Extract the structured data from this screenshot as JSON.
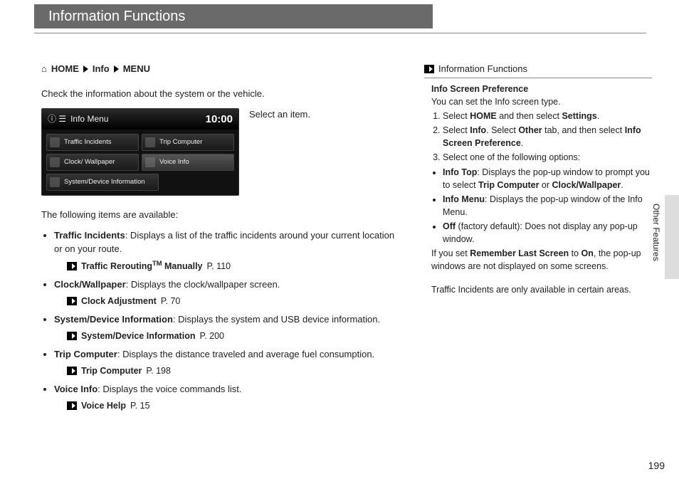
{
  "title": "Information Functions",
  "breadcrumb": {
    "home": "HOME",
    "info": "Info",
    "menu": "MENU"
  },
  "intro": "Check the information about the system or the vehicle.",
  "screenshot": {
    "header_label": "Info Menu",
    "clock": "10:00",
    "buttons": {
      "traffic": "Traffic Incidents",
      "trip": "Trip Computer",
      "clockwp": "Clock/ Wallpaper",
      "voice": "Voice Info",
      "sysdev": "System/Device Information"
    }
  },
  "select_item": "Select an item.",
  "items_intro": "The following items are available:",
  "features": {
    "traffic": {
      "label": "Traffic Incidents",
      "desc": ": Displays a list of the traffic incidents around your current location or on your route.",
      "xref": "Traffic Rerouting",
      "tm": "TM",
      "xref_suffix": " Manually",
      "page": "P. 110"
    },
    "clockwp": {
      "label": "Clock/Wallpaper",
      "desc": ": Displays the clock/wallpaper screen.",
      "xref": "Clock Adjustment",
      "page": "P. 70"
    },
    "sysdev": {
      "label": "System/Device Information",
      "desc": ": Displays the system and USB device information.",
      "xref": "System/Device Information",
      "page": "P. 200"
    },
    "trip": {
      "label": "Trip Computer",
      "desc": ": Displays the distance traveled and average fuel consumption.",
      "xref": "Trip Computer",
      "page": "P. 198"
    },
    "voice": {
      "label": "Voice Info",
      "desc": ": Displays the voice commands list.",
      "xref": "Voice Help",
      "page": "P. 15"
    }
  },
  "sidebar": {
    "header": "Information Functions",
    "pref_title": "Info Screen Preference",
    "pref_intro": "You can set the Info screen type.",
    "step1a": "Select ",
    "step1b": "HOME",
    "step1c": " and then select ",
    "step1d": "Settings",
    "step1e": ".",
    "step2a": "Select ",
    "step2b": "Info",
    "step2c": ". Select ",
    "step2d": "Other",
    "step2e": " tab, and then select ",
    "step2f": "Info Screen Preference",
    "step2g": ".",
    "step3": "Select one of the following options:",
    "opt1a": "Info Top",
    "opt1b": ": Displays the pop-up window to prompt you to select ",
    "opt1c": "Trip Computer",
    "opt1d": " or ",
    "opt1e": "Clock/Wallpaper",
    "opt1f": ".",
    "opt2a": "Info Menu",
    "opt2b": ": Displays the pop-up window of the Info Menu.",
    "opt3a": "Off",
    "opt3b": " (factory default): Does not display any pop-up window.",
    "note1a": "If you set ",
    "note1b": "Remember Last Screen",
    "note1c": " to ",
    "note1d": "On",
    "note1e": ", the pop-up windows are not displayed on some screens.",
    "note2": "Traffic Incidents are only available in certain areas."
  },
  "side_label": "Other Features",
  "page_num": "199"
}
